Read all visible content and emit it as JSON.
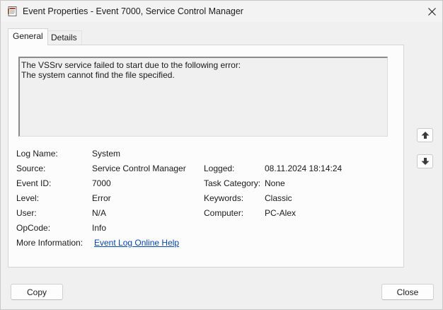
{
  "window": {
    "title": "Event Properties - Event 7000, Service Control Manager",
    "app_icon": "event-properties-icon",
    "close_icon": "close-icon"
  },
  "tabs": [
    {
      "label": "General",
      "active": true
    },
    {
      "label": "Details",
      "active": false
    }
  ],
  "description": {
    "line1": "The VSSrv service failed to start due to the following error:",
    "line2": "The system cannot find the file specified."
  },
  "fields": {
    "log_name": {
      "label": "Log Name:",
      "value": "System"
    },
    "source": {
      "label": "Source:",
      "value": "Service Control Manager"
    },
    "logged": {
      "label": "Logged:",
      "value": "08.11.2024 18:14:24"
    },
    "event_id": {
      "label": "Event ID:",
      "value": "7000"
    },
    "task_category": {
      "label": "Task Category:",
      "value": "None"
    },
    "level": {
      "label": "Level:",
      "value": "Error"
    },
    "keywords": {
      "label": "Keywords:",
      "value": "Classic"
    },
    "user": {
      "label": "User:",
      "value": "N/A"
    },
    "computer": {
      "label": "Computer:",
      "value": "PC-Alex"
    },
    "opcode": {
      "label": "OpCode:",
      "value": "Info"
    },
    "more_info": {
      "label": "More Information:",
      "value": "Event Log Online Help"
    }
  },
  "navigation": {
    "up_icon": "arrow-up-icon",
    "down_icon": "arrow-down-icon"
  },
  "buttons": {
    "copy": "Copy",
    "close": "Close"
  },
  "colors": {
    "link": "#0645ad",
    "panel_bg": "#fcfcfc",
    "window_bg": "#f0f0f0"
  }
}
